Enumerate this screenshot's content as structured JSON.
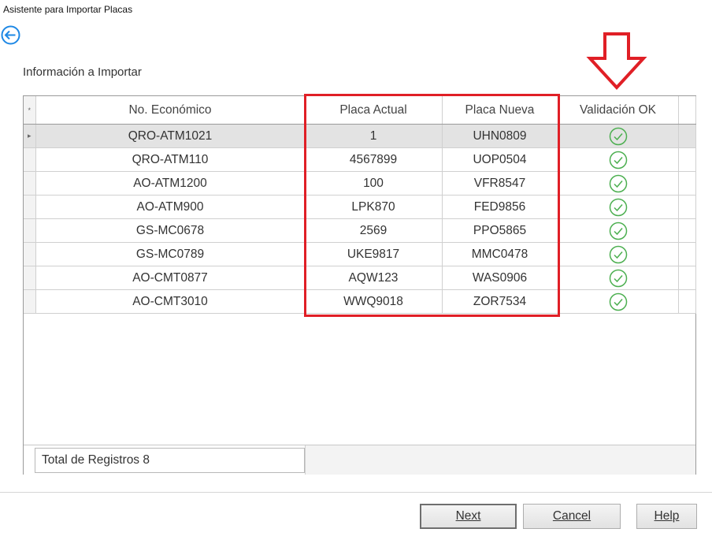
{
  "window": {
    "title": "Asistente para Importar Placas"
  },
  "section": {
    "label": "Información a Importar"
  },
  "grid": {
    "new_row_marker": "*",
    "current_row_marker": "▸",
    "columns": [
      "No. Económico",
      "Placa Actual",
      "Placa Nueva",
      "Validación OK"
    ],
    "rows": [
      {
        "eco": "QRO-ATM1021",
        "actual": "1",
        "nueva": "UHN0809",
        "valid": "check-icon"
      },
      {
        "eco": "QRO-ATM110",
        "actual": "4567899",
        "nueva": "UOP0504",
        "valid": "check-icon"
      },
      {
        "eco": "AO-ATM1200",
        "actual": "100",
        "nueva": "VFR8547",
        "valid": "check-icon"
      },
      {
        "eco": "AO-ATM900",
        "actual": "LPK870",
        "nueva": "FED9856",
        "valid": "check-icon"
      },
      {
        "eco": "GS-MC0678",
        "actual": "2569",
        "nueva": "PPO5865",
        "valid": "check-icon"
      },
      {
        "eco": "GS-MC0789",
        "actual": "UKE9817",
        "nueva": "MMC0478",
        "valid": "check-icon"
      },
      {
        "eco": "AO-CMT0877",
        "actual": "AQW123",
        "nueva": "WAS0906",
        "valid": "check-icon"
      },
      {
        "eco": "AO-CMT3010",
        "actual": "WWQ9018",
        "nueva": "ZOR7534",
        "valid": "check-icon"
      }
    ],
    "total_label": "Total de Registros 8"
  },
  "buttons": {
    "next": "Next",
    "cancel": "Cancel",
    "help": "Help"
  },
  "colors": {
    "accent": "#1e88e5",
    "valid_check": "#4caf50",
    "annotation_red": "#e01f26"
  }
}
